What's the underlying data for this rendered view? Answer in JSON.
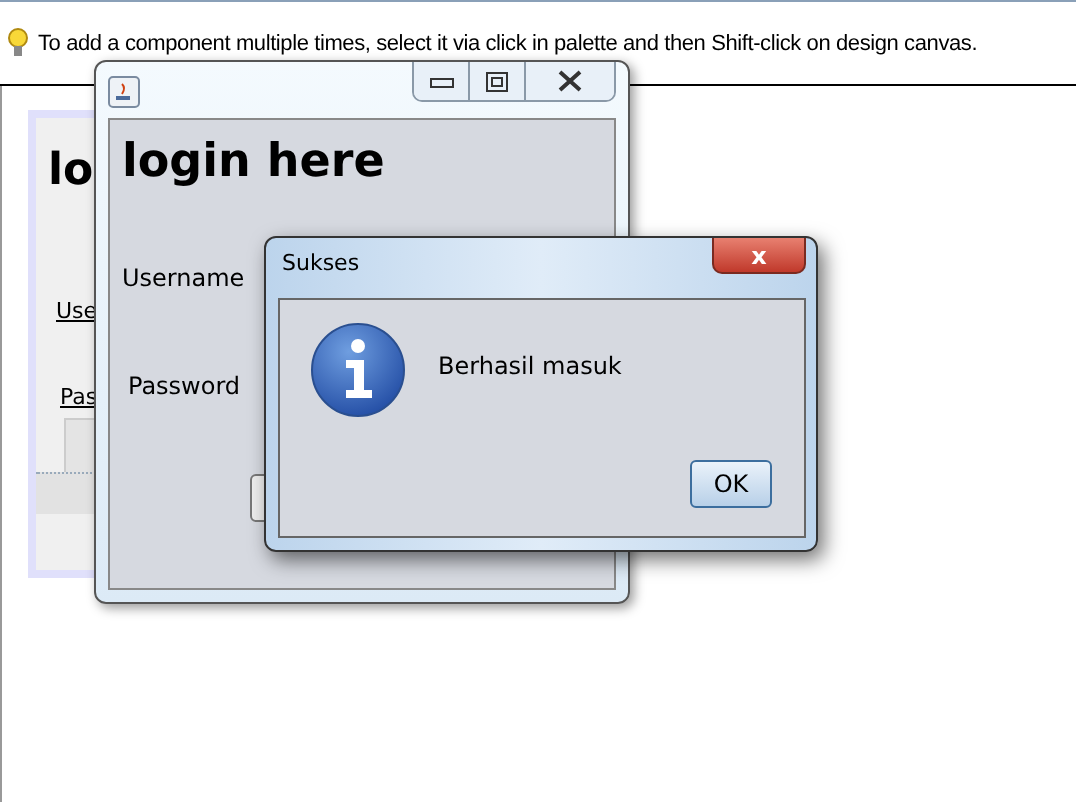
{
  "hint": {
    "text": "To add a component multiple times, select it via click in palette and then Shift-click on design canvas."
  },
  "design_form": {
    "title": "lo",
    "username_label": "Use",
    "password_label": "Pas"
  },
  "login_window": {
    "heading": "login here",
    "username_label": "Username",
    "password_label": "Password"
  },
  "dialog": {
    "title": "Sukses",
    "message": "Berhasil masuk",
    "close": "x",
    "buttons": [
      "OK"
    ]
  }
}
